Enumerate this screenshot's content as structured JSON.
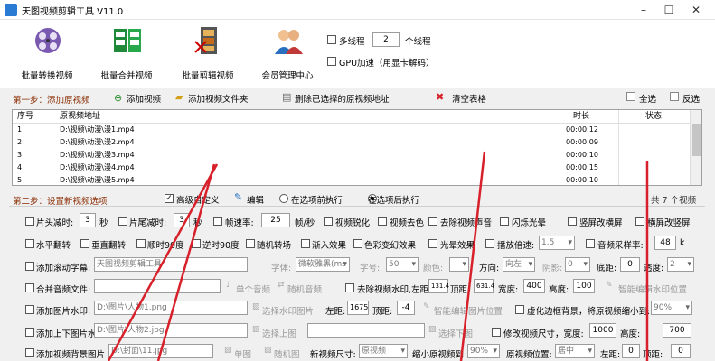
{
  "window": {
    "title": "天图视频剪辑工具 V11.0",
    "min": "–",
    "max": "☐",
    "close": "✕"
  },
  "toolbar": {
    "buttons": [
      {
        "label": "批量转换视频",
        "icon": "film-reel-icon"
      },
      {
        "label": "批量合并视频",
        "icon": "film-merge-icon"
      },
      {
        "label": "批量剪辑视频",
        "icon": "film-cut-icon"
      },
      {
        "label": "会员管理中心",
        "icon": "members-icon"
      }
    ],
    "multithread_label": "多线程",
    "thread_count": "2",
    "thread_unit": "个线程",
    "gpu_label": "GPU加速（用显卡解码）"
  },
  "step1": {
    "title": "第一步：添加原视频",
    "add_video": "添加视频",
    "add_folder": "添加视频文件夹",
    "delete_selected": "删除已选择的原视频地址",
    "clear_table": "清空表格",
    "select_all": "全选",
    "invert": "反选"
  },
  "table": {
    "headers": [
      "序号",
      "原视频地址",
      "时长",
      "状态"
    ],
    "rows": [
      {
        "no": "1",
        "path": "D:\\视频\\动漫\\漫1.mp4",
        "dur": "00:00:12",
        "state": ""
      },
      {
        "no": "2",
        "path": "D:\\视频\\动漫\\漫2.mp4",
        "dur": "00:00:09",
        "state": ""
      },
      {
        "no": "3",
        "path": "D:\\视频\\动漫\\漫3.mp4",
        "dur": "00:00:10",
        "state": ""
      },
      {
        "no": "4",
        "path": "D:\\视频\\动漫\\漫4.mp4",
        "dur": "00:00:15",
        "state": ""
      },
      {
        "no": "5",
        "path": "D:\\视频\\动漫\\漫5.mp4",
        "dur": "00:00:10",
        "state": ""
      }
    ]
  },
  "step2": {
    "title": "第二步：设置新视频选项",
    "advanced": "高级自定义",
    "edit": "编辑",
    "before_label": "在选项前执行",
    "after_label": "在选项后执行",
    "count": "共 7 个视频"
  },
  "opts": {
    "r1": {
      "head_cut": "片头减时:",
      "head_val": "3",
      "sec": "秒",
      "tail_cut": "片尾减时:",
      "tail_val": "3",
      "fps_label": "帧速率:",
      "fps_val": "25",
      "fps_unit": "帧/秒",
      "sharpen": "视频锐化",
      "decolor": "视频去色",
      "mute": "去除视频声音",
      "flash": "闪烁光晕",
      "v2h": "竖屏改横屏",
      "h2v": "横屏改竖屏"
    },
    "r2": {
      "hflip": "水平翻转",
      "vflip": "垂直翻转",
      "cw90": "顺时90度",
      "ccw90": "逆时90度",
      "random_trans": "随机转场",
      "fade_in": "渐入效果",
      "color_shift": "色彩变幻效果",
      "glow": "光晕效果",
      "speed": "播放倍速:",
      "speed_val": "1.5",
      "sample": "音频采样率:",
      "sample_val": "48",
      "sample_unit": "k"
    },
    "r3": {
      "scroll_sub": "添加滚动字幕:",
      "scroll_text": "天图视频剪辑工具",
      "font_label": "字体:",
      "font_val": "微软雅黑(ms",
      "size_label": "字号:",
      "size_val": "50",
      "color_label": "颜色:",
      "dir_label": "方向:",
      "dir_val": "向左",
      "shadow_label": "阴影:",
      "shadow_val": "0",
      "bottom_label": "底距:",
      "bottom_val": "0",
      "opacity_label": "透度:",
      "opacity_val": "2"
    },
    "r4": {
      "merge_audio": "合并音频文件:",
      "single_audio": "单个音频",
      "random_audio": "随机音频",
      "remove_wm": "去除视频水印,左距:",
      "left_val": "131.4",
      "top_label": "顶距:",
      "top_val": "631.4",
      "width_label": "宽度:",
      "width_val": "400",
      "height_label": "高度:",
      "height_val": "100",
      "smart_wm": "智能编辑水印位置"
    },
    "r5": {
      "add_image": "添加图片水印:",
      "image_path": "D:\\图片\\人物1.png",
      "choose_wm": "选择水印图片",
      "left_label": "左距:",
      "left_val": "1675",
      "top_label": "顶距:",
      "top_val": "-4",
      "smart_img": "智能编辑图片位置",
      "blur_bg": "虚化边框背景，将原视频缩小到:",
      "blur_val": "90%"
    },
    "r6": {
      "add_header": "添加上下图片水印:",
      "header_path": "D:\\图片\\人物2.jpg",
      "choose_top": "选择上图",
      "choose_bottom": "选择下图",
      "modify_size": "修改视频尺寸，宽度:",
      "w_val": "1000",
      "h_label": "高度:",
      "h_val": "700"
    },
    "r7": {
      "add_bg": "添加视频背景图片",
      "bg_path": "D:\\封面\\11.jpg",
      "single_img": "单图",
      "random_img": "随机图",
      "new_size": "新视频尺寸:",
      "new_size_val": "原视频",
      "shrink": "缩小原视频到",
      "shrink_val": "90%",
      "pos": "原视频位置:",
      "pos_val": "居中",
      "left_label": "左距:",
      "left_val": "0",
      "top_label": "顶距:",
      "top_val": "0"
    }
  },
  "colors": {
    "accent_red": "#d8202a",
    "step_color": "#8a2b00"
  }
}
